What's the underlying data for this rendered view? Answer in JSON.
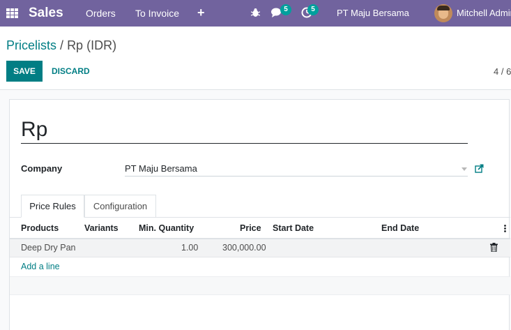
{
  "navbar": {
    "app_name": "Sales",
    "menu": [
      "Orders",
      "To Invoice"
    ],
    "plus": "+",
    "chat_count": "5",
    "activity_count": "5",
    "company": "PT Maju Bersama",
    "user": "Mitchell Admin"
  },
  "breadcrumb": {
    "parent": "Pricelists",
    "separator": "/",
    "current": "Rp (IDR)"
  },
  "actions": {
    "save": "SAVE",
    "discard": "DISCARD"
  },
  "pager": "4 / 6",
  "form": {
    "name": "Rp",
    "company_label": "Company",
    "company_value": "PT Maju Bersama"
  },
  "tabs": [
    "Price Rules",
    "Configuration"
  ],
  "table": {
    "headers": [
      "Products",
      "Variants",
      "Min. Quantity",
      "Price",
      "Start Date",
      "End Date"
    ],
    "rows": [
      {
        "product": "Deep Dry Pan",
        "variants": "",
        "min_qty": "1.00",
        "price": "300,000.00",
        "start": "",
        "end": ""
      }
    ],
    "add_line": "Add a line"
  },
  "colors": {
    "navbar": "#71639e",
    "primary": "#017e84",
    "badge": "#00a09d"
  },
  "icons": [
    "apps-grid-icon",
    "plus-icon",
    "bug-icon",
    "chat-icon",
    "clock-icon",
    "external-link-icon",
    "trash-icon",
    "kebab-menu-icon"
  ]
}
